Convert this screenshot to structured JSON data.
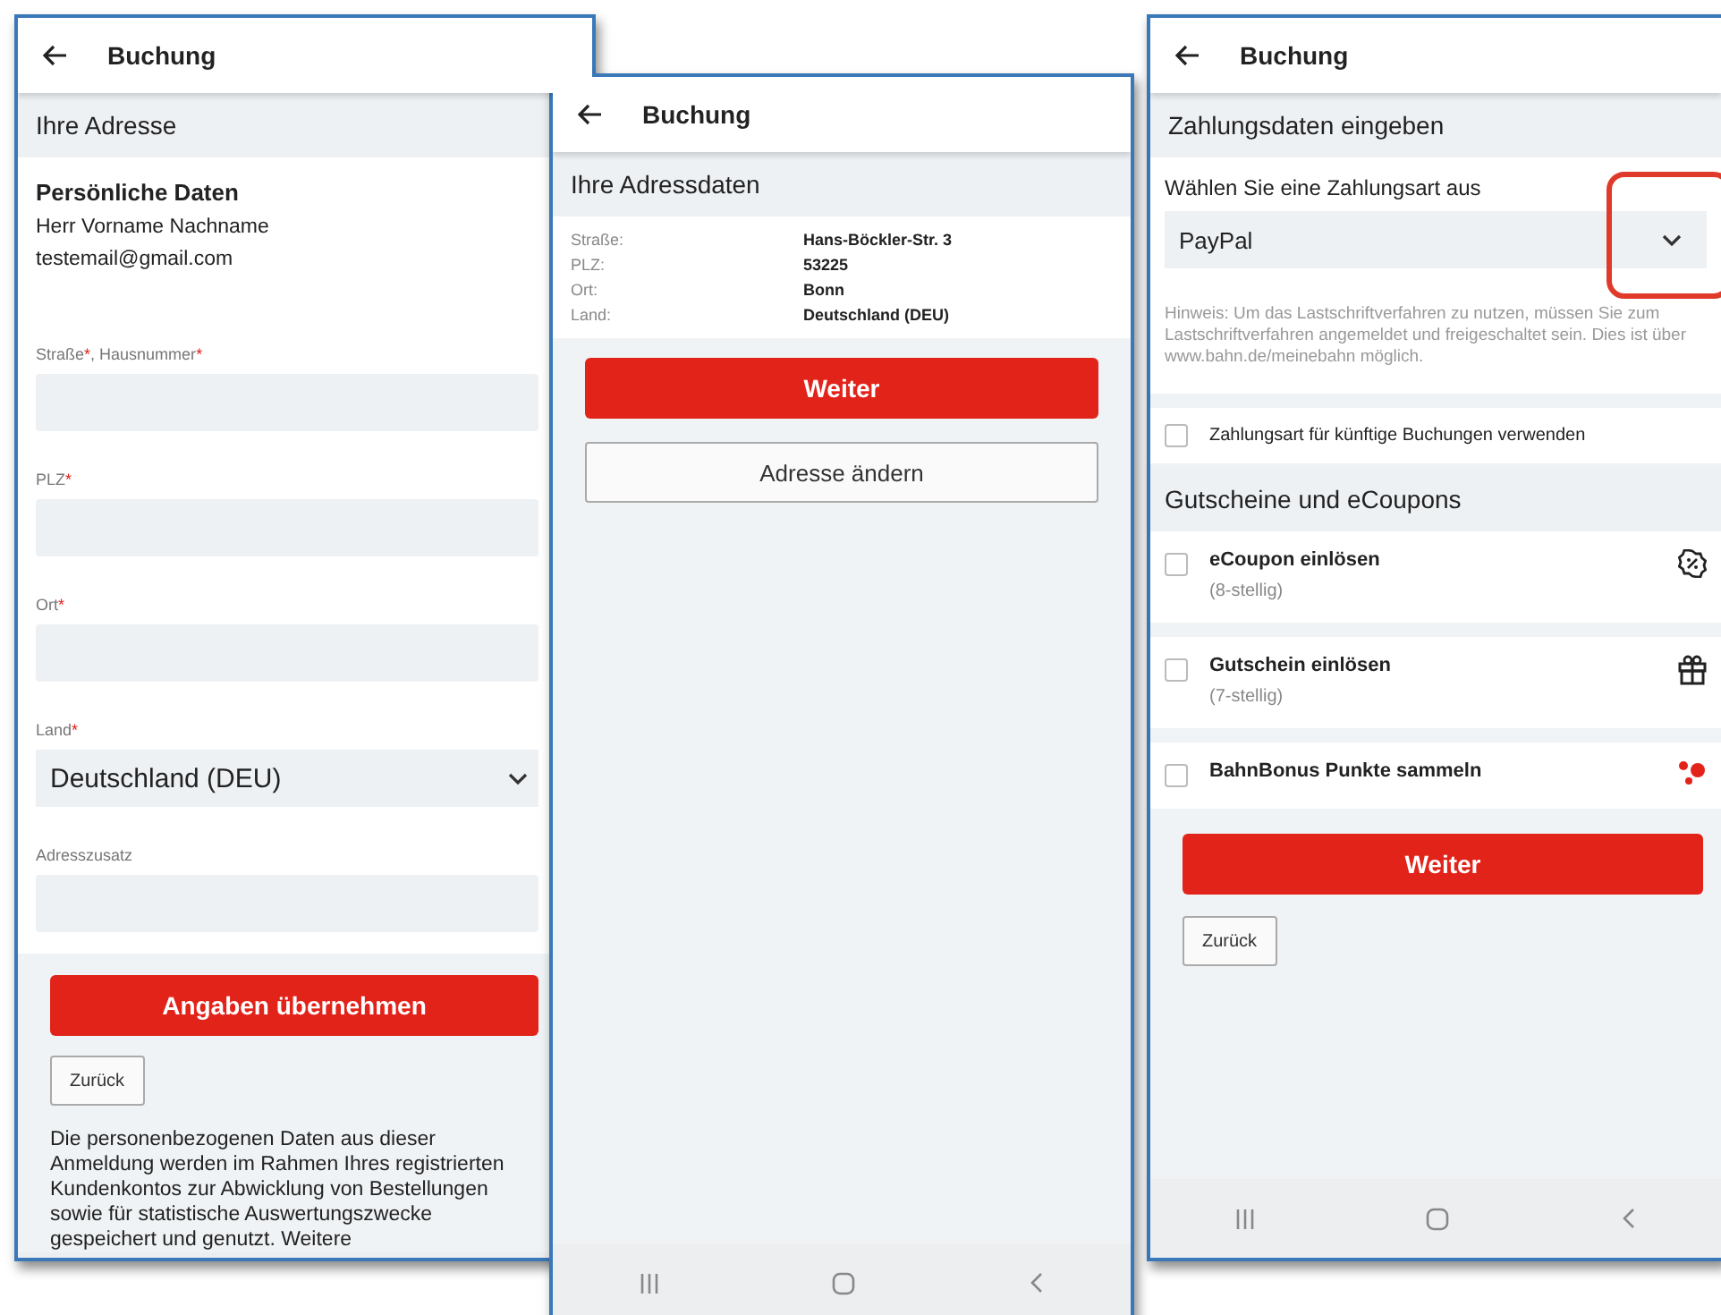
{
  "address_form": {
    "title": "Buchung",
    "section": "Ihre Adresse",
    "personal_heading": "Persönliche Daten",
    "personal_lines": [
      "Herr Vorname Nachname",
      "testemail@gmail.com"
    ],
    "fields": [
      {
        "kind": "text",
        "label_parts": [
          {
            "kind": "plain",
            "text": "Straße"
          },
          {
            "kind": "required",
            "text": "*"
          },
          {
            "kind": "plain",
            "text": ", Hausnummer"
          },
          {
            "kind": "required",
            "text": "*"
          }
        ]
      },
      {
        "kind": "text",
        "label_parts": [
          {
            "kind": "plain",
            "text": "PLZ"
          },
          {
            "kind": "required",
            "text": "*"
          }
        ]
      },
      {
        "kind": "text",
        "label_parts": [
          {
            "kind": "plain",
            "text": "Ort"
          },
          {
            "kind": "required",
            "text": "*"
          }
        ]
      },
      {
        "kind": "select",
        "label_parts": [
          {
            "kind": "plain",
            "text": "Land"
          },
          {
            "kind": "required",
            "text": "*"
          }
        ],
        "value": "Deutschland (DEU)"
      },
      {
        "kind": "text",
        "label_parts": [
          {
            "kind": "plain",
            "text": "Adresszusatz"
          }
        ]
      }
    ],
    "primary_button": "Angaben übernehmen",
    "back_button": "Zurück",
    "notice": "Die personenbezogenen Daten aus dieser Anmeldung werden im Rahmen Ihres registrierten Kundenkontos zur Abwicklung von Bestellungen sowie für statistische Auswertungszwecke gespeichert und genutzt. Weitere"
  },
  "address_summary": {
    "title": "Buchung",
    "section": "Ihre Adressdaten",
    "rows": [
      {
        "label": "Straße:",
        "value": "Hans-Böckler-Str. 3"
      },
      {
        "label": "PLZ:",
        "value": "53225"
      },
      {
        "label": "Ort:",
        "value": "Bonn"
      },
      {
        "label": "Land:",
        "value": "Deutschland (DEU)"
      }
    ],
    "primary_button": "Weiter",
    "secondary_button": "Adresse ändern"
  },
  "payment": {
    "title": "Buchung",
    "section": "Zahlungsdaten eingeben",
    "select_label": "Wählen Sie eine Zahlungsart aus",
    "select_value": "PayPal",
    "hint": "Hinweis: Um das Lastschriftverfahren zu nutzen, müssen Sie zum Lastschriftverfahren angemeldet und freigeschaltet sein. Dies ist über www.bahn.de/meinebahn möglich.",
    "remember": {
      "label": "Zahlungsart für künftige Buchungen verwenden",
      "checked": false
    },
    "voucher_section": "Gutscheine und eCoupons",
    "vouchers": [
      {
        "kind": "ecoupon",
        "title": "eCoupon einlösen",
        "subtitle": "(8-stellig)",
        "checked": false
      },
      {
        "kind": "gift",
        "title": "Gutschein einlösen",
        "subtitle": "(7-stellig)",
        "checked": false
      },
      {
        "kind": "bonus",
        "title": "BahnBonus Punkte sammeln",
        "checked": false
      }
    ],
    "primary_button": "Weiter",
    "back_button": "Zurück"
  }
}
